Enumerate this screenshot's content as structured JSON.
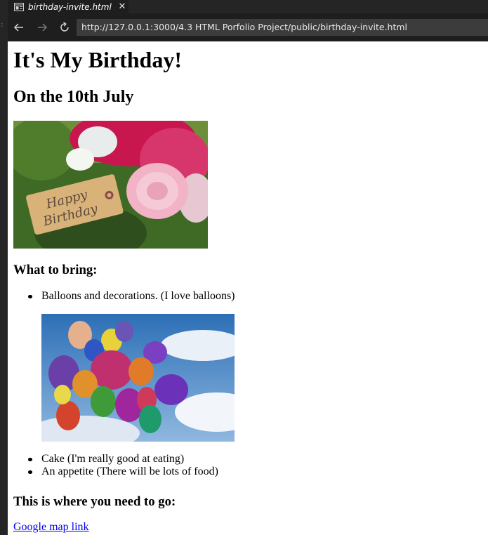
{
  "window": {
    "tab_title": "birthday-invite.html",
    "url": "http://127.0.0.1:3000/4.3 HTML Porfolio Project/public/birthday-invite.html"
  },
  "page": {
    "heading": "It's My Birthday!",
    "subheading": "On the 10th July",
    "hero_image_text": [
      "Happy",
      "Birthday"
    ],
    "bring_heading": "What to bring:",
    "items": [
      "Balloons and decorations. (I love balloons)",
      "Cake (I'm really good at eating)",
      "An appetite (There will be lots of food)"
    ],
    "where_heading": "This is where you need to go:",
    "map_link": "Google map link"
  },
  "icons": {
    "back": "arrow-left-icon",
    "forward": "arrow-right-icon",
    "reload": "reload-icon",
    "close": "close-icon",
    "page": "preview-page-icon"
  },
  "colors": {
    "chrome_bg": "#1e1e1e",
    "address_bg": "#3c3c3c",
    "link": "#0000ee"
  }
}
